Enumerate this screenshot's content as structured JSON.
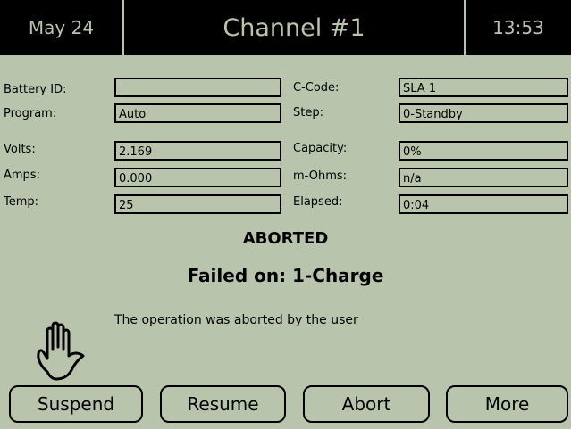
{
  "header": {
    "date": "May 24",
    "title": "Channel #1",
    "time": "13:53"
  },
  "fields": {
    "battery_id": {
      "label": "Battery ID:",
      "value": ""
    },
    "program": {
      "label": "Program:",
      "value": "Auto"
    },
    "volts": {
      "label": "Volts:",
      "value": "2.169"
    },
    "amps": {
      "label": "Amps:",
      "value": "0.000"
    },
    "temp": {
      "label": "Temp:",
      "value": "25"
    },
    "c_code": {
      "label": "C-Code:",
      "value": "SLA 1"
    },
    "step": {
      "label": "Step:",
      "value": "0-Standby"
    },
    "capacity": {
      "label": "Capacity:",
      "value": "0%"
    },
    "m_ohms": {
      "label": "m-Ohms:",
      "value": "n/a"
    },
    "elapsed": {
      "label": "Elapsed:",
      "value": "0:04"
    }
  },
  "status": {
    "state": "ABORTED",
    "failed": "Failed on: 1-Charge",
    "message": "The operation was aborted by the user",
    "icon": "hand-stop-icon"
  },
  "buttons": {
    "suspend": "Suspend",
    "resume": "Resume",
    "abort": "Abort",
    "more": "More"
  },
  "colors": {
    "background": "#b9c4ad",
    "header_bg": "#000000",
    "header_text": "#b9c4ad"
  }
}
